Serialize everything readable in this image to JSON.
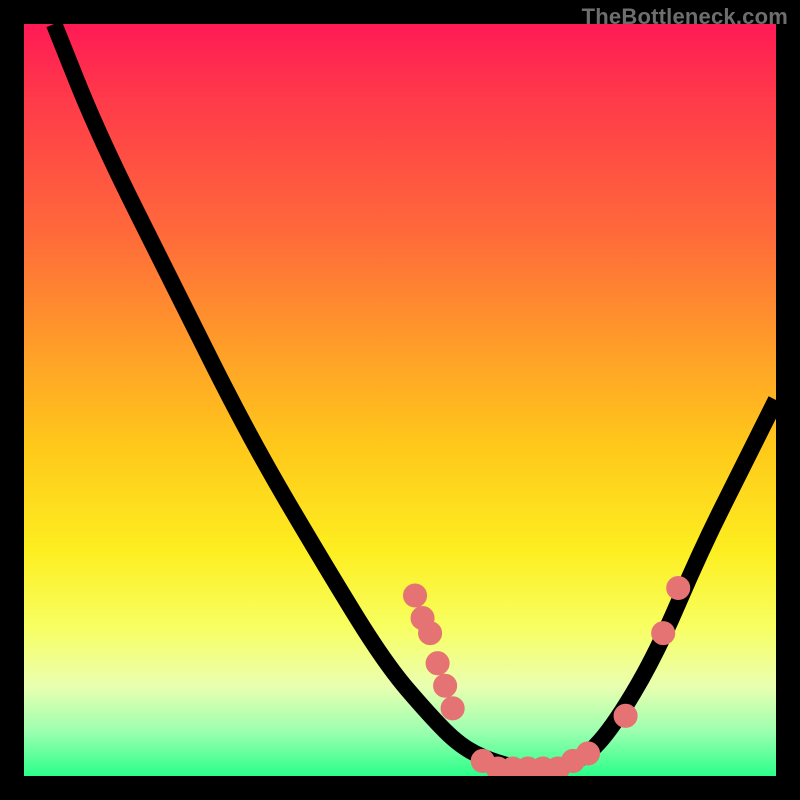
{
  "watermark": "TheBottleneck.com",
  "chart_data": {
    "type": "line",
    "title": "",
    "xlabel": "",
    "ylabel": "",
    "xlim": [
      0,
      100
    ],
    "ylim": [
      0,
      100
    ],
    "grid": false,
    "legend": false,
    "background": "rainbow-gradient",
    "curve_points": [
      {
        "x": 4,
        "y": 100
      },
      {
        "x": 10,
        "y": 85
      },
      {
        "x": 20,
        "y": 65
      },
      {
        "x": 30,
        "y": 45
      },
      {
        "x": 40,
        "y": 28
      },
      {
        "x": 48,
        "y": 15
      },
      {
        "x": 54,
        "y": 8
      },
      {
        "x": 58,
        "y": 4
      },
      {
        "x": 62,
        "y": 2
      },
      {
        "x": 66,
        "y": 1
      },
      {
        "x": 70,
        "y": 1
      },
      {
        "x": 74,
        "y": 2
      },
      {
        "x": 78,
        "y": 6
      },
      {
        "x": 84,
        "y": 16
      },
      {
        "x": 90,
        "y": 30
      },
      {
        "x": 96,
        "y": 42
      },
      {
        "x": 100,
        "y": 50
      }
    ],
    "markers": [
      {
        "x": 52,
        "y": 24
      },
      {
        "x": 53,
        "y": 21
      },
      {
        "x": 54,
        "y": 19
      },
      {
        "x": 55,
        "y": 15
      },
      {
        "x": 56,
        "y": 12
      },
      {
        "x": 57,
        "y": 9
      },
      {
        "x": 61,
        "y": 2
      },
      {
        "x": 63,
        "y": 1
      },
      {
        "x": 65,
        "y": 1
      },
      {
        "x": 67,
        "y": 1
      },
      {
        "x": 69,
        "y": 1
      },
      {
        "x": 71,
        "y": 1
      },
      {
        "x": 73,
        "y": 2
      },
      {
        "x": 75,
        "y": 3
      },
      {
        "x": 80,
        "y": 8
      },
      {
        "x": 85,
        "y": 19
      },
      {
        "x": 87,
        "y": 25
      }
    ],
    "colors": {
      "curve": "#000000",
      "marker": "#e57373",
      "gradient_top": "#ff1a55",
      "gradient_bottom": "#2bff8a"
    }
  }
}
